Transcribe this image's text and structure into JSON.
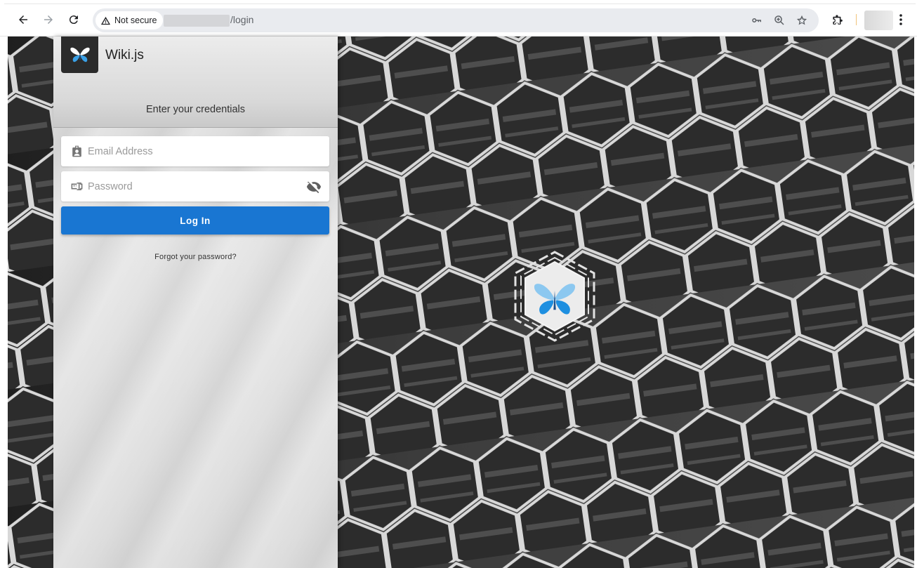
{
  "browser": {
    "security_label": "Not secure",
    "url_path": "/login"
  },
  "site": {
    "title": "Wiki.js"
  },
  "login": {
    "heading": "Enter your credentials",
    "email_placeholder": "Email Address",
    "password_placeholder": "Password",
    "submit_label": "Log In",
    "forgot_label": "Forgot your password?"
  },
  "icons": {
    "back": "arrow-left-icon",
    "forward": "arrow-right-icon",
    "reload": "reload-icon",
    "security": "warning-triangle-icon",
    "password_manager": "key-icon",
    "zoom": "zoom-icon",
    "bookmark": "star-icon",
    "extensions": "puzzle-icon",
    "menu": "kebab-menu-icon",
    "email_field": "contact-card-icon",
    "password_field": "textbox-password-icon",
    "password_toggle": "eye-off-icon",
    "brand_logo": "butterfly-logo-icon"
  },
  "colors": {
    "primary": "#1976d2",
    "logo_blue": "#3aa0e6"
  }
}
